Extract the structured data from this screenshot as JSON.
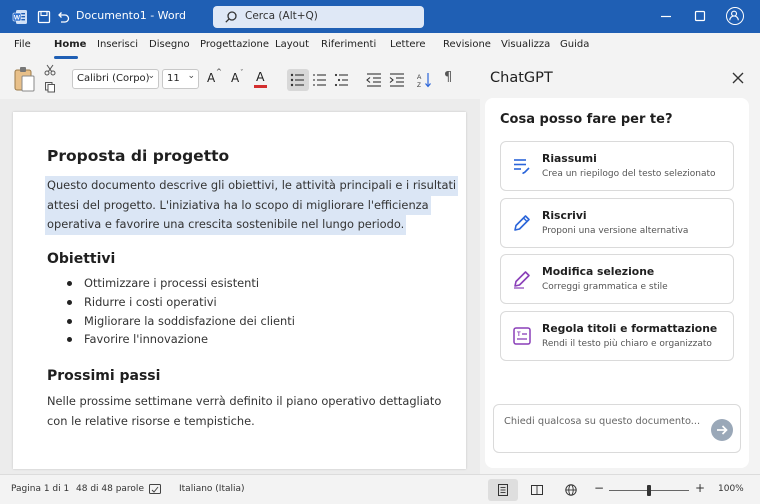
{
  "titlebar": {
    "doc_title": "Documento1 - Word",
    "search_placeholder": "Cerca (Alt+Q)"
  },
  "menu": {
    "tabs": [
      "File",
      "Home",
      "Inserisci",
      "Disegno",
      "Progettazione",
      "Layout",
      "Riferimenti",
      "Lettere",
      "Revisione",
      "Visualizza",
      "Guida"
    ],
    "active": "Home"
  },
  "ribbon": {
    "font_name": "Calibri (Corpo)",
    "font_size": "11",
    "grow_font": "A",
    "shrink_font": "A",
    "font_color": "A",
    "font_color_hex": "#d32f2f",
    "pilcrow": "¶"
  },
  "document": {
    "title": "Proposta di progetto",
    "intro_lines": [
      "Questo documento descrive gli obiettivi, le attività principali e i risultati",
      "attesi del progetto. L'iniziativa ha lo scopo di migliorare l'efficienza",
      "operativa e favorire una crescita sostenibile nel lungo periodo."
    ],
    "section1_heading": "Obiettivi",
    "bullets": [
      "Ottimizzare i processi esistenti",
      "Ridurre i costi operativi",
      "Migliorare la soddisfazione dei clienti",
      "Favorire l'innovazione"
    ],
    "section2_heading": "Prossimi passi",
    "next_lines": [
      "Nelle prossime settimane verrà definito il piano operativo dettagliato",
      "con le relative risorse e tempistiche."
    ],
    "highlight_color": "#dbe6f5"
  },
  "panel": {
    "title": "ChatGPT",
    "question": "Cosa posso fare per te?",
    "actions": [
      {
        "title": "Riassumi",
        "subtitle": "Crea un riepilogo del testo selezionato",
        "icon": "summary-lines-icon",
        "color": "#2b65d9"
      },
      {
        "title": "Riscrivi",
        "subtitle": "Proponi una versione alternativa",
        "icon": "pencil-icon",
        "color": "#2b65d9"
      },
      {
        "title": "Modifica selezione",
        "subtitle": "Correggi grammatica e stile",
        "icon": "edit-pen-icon",
        "color": "#8a3fb8"
      },
      {
        "title": "Regola titoli e formattazione",
        "subtitle": "Rendi il testo più chiaro e organizzato",
        "icon": "format-heading-icon",
        "color": "#8a3fb8"
      }
    ],
    "input_placeholder": "Chiedi qualcosa su questo documento..."
  },
  "status": {
    "page": "Pagina 1 di 1",
    "words": "48 di 48 parole",
    "language": "Italiano (Italia)",
    "zoom_minus": "−",
    "zoom_plus": "+",
    "zoom": "100%",
    "zoom_level": 1.0
  },
  "colors": {
    "titlebar": "#1f5fb4",
    "accent": "#1f5fb4"
  }
}
